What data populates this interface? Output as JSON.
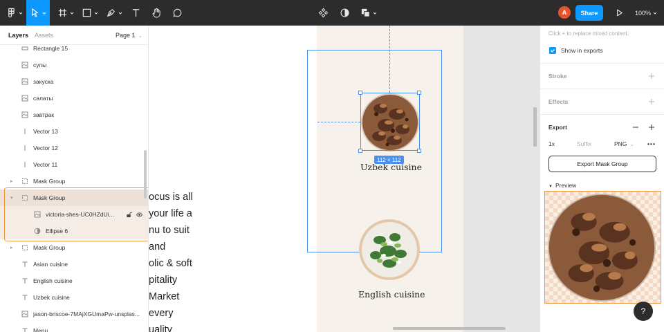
{
  "toolbar": {
    "avatar_initial": "A",
    "share_label": "Share",
    "zoom_label": "100%",
    "colors": {
      "bg": "#2c2c2c",
      "accent": "#0d99ff",
      "avatar": "#e8552a"
    },
    "icons": [
      "figma-menu-icon",
      "move-tool-icon",
      "frame-tool-icon",
      "shape-tool-icon",
      "pen-tool-icon",
      "text-tool-icon",
      "hand-tool-icon",
      "comment-tool-icon",
      "component-icon",
      "mask-icon",
      "boolean-icon",
      "present-icon"
    ]
  },
  "left_panel": {
    "tabs": {
      "layers": "Layers",
      "assets": "Assets"
    },
    "page_selector": "Page 1",
    "layers": [
      {
        "name": "Rectangle 15",
        "icon": "rectangle-icon",
        "indent": 1
      },
      {
        "name": "супы",
        "icon": "image-icon",
        "indent": 1
      },
      {
        "name": "закуска",
        "icon": "image-icon",
        "indent": 1
      },
      {
        "name": "салаты",
        "icon": "image-icon",
        "indent": 1
      },
      {
        "name": "завтрак",
        "icon": "image-icon",
        "indent": 1
      },
      {
        "name": "Vector 13",
        "icon": "vector-icon",
        "indent": 1
      },
      {
        "name": "Vector 12",
        "icon": "vector-icon",
        "indent": 1
      },
      {
        "name": "Vector 11",
        "icon": "vector-icon",
        "indent": 1
      },
      {
        "name": "Mask Group",
        "icon": "mask-group-icon",
        "indent": 1,
        "collapsed": true
      },
      {
        "name": "Mask Group",
        "icon": "mask-group-icon",
        "indent": 1,
        "expanded": true,
        "selected": true
      },
      {
        "name": "victoria-shes-UC0HZdUi...",
        "icon": "image-icon",
        "indent": 2,
        "selected": true
      },
      {
        "name": "Ellipse 6",
        "icon": "mask-icon",
        "indent": 2,
        "selected": true
      },
      {
        "name": "Mask Group",
        "icon": "mask-group-icon",
        "indent": 1,
        "collapsed": true
      },
      {
        "name": "Asian cuisine",
        "icon": "text-icon",
        "indent": 1
      },
      {
        "name": "English cuisine",
        "icon": "text-icon",
        "indent": 1
      },
      {
        "name": "Uzbek cuisine",
        "icon": "text-icon",
        "indent": 1
      },
      {
        "name": "jason-briscoe-7MAjXGUmaPw-unsplas...",
        "icon": "image-icon",
        "indent": 1
      },
      {
        "name": "Menu",
        "icon": "text-icon",
        "indent": 1
      }
    ]
  },
  "canvas": {
    "left_text_lines": [
      "ocus is all",
      "your life a",
      "nu to suit",
      "and",
      "olic & soft",
      "pitality",
      "Market",
      "every",
      "uality"
    ],
    "cuisine_titles": {
      "uzbek": "Uzbek cuisine",
      "english": "English cuisine"
    },
    "selection_size": "112 × 112"
  },
  "right_panel": {
    "fill_hint": "Click + to replace mixed content.",
    "show_in_exports_label": "Show in exports",
    "stroke_label": "Stroke",
    "effects_label": "Effects",
    "export_label": "Export",
    "scale_value": "1x",
    "suffix_placeholder": "Suffix",
    "format_value": "PNG",
    "export_button_label": "Export Mask Group",
    "preview_label": "Preview",
    "help_label": "?"
  }
}
